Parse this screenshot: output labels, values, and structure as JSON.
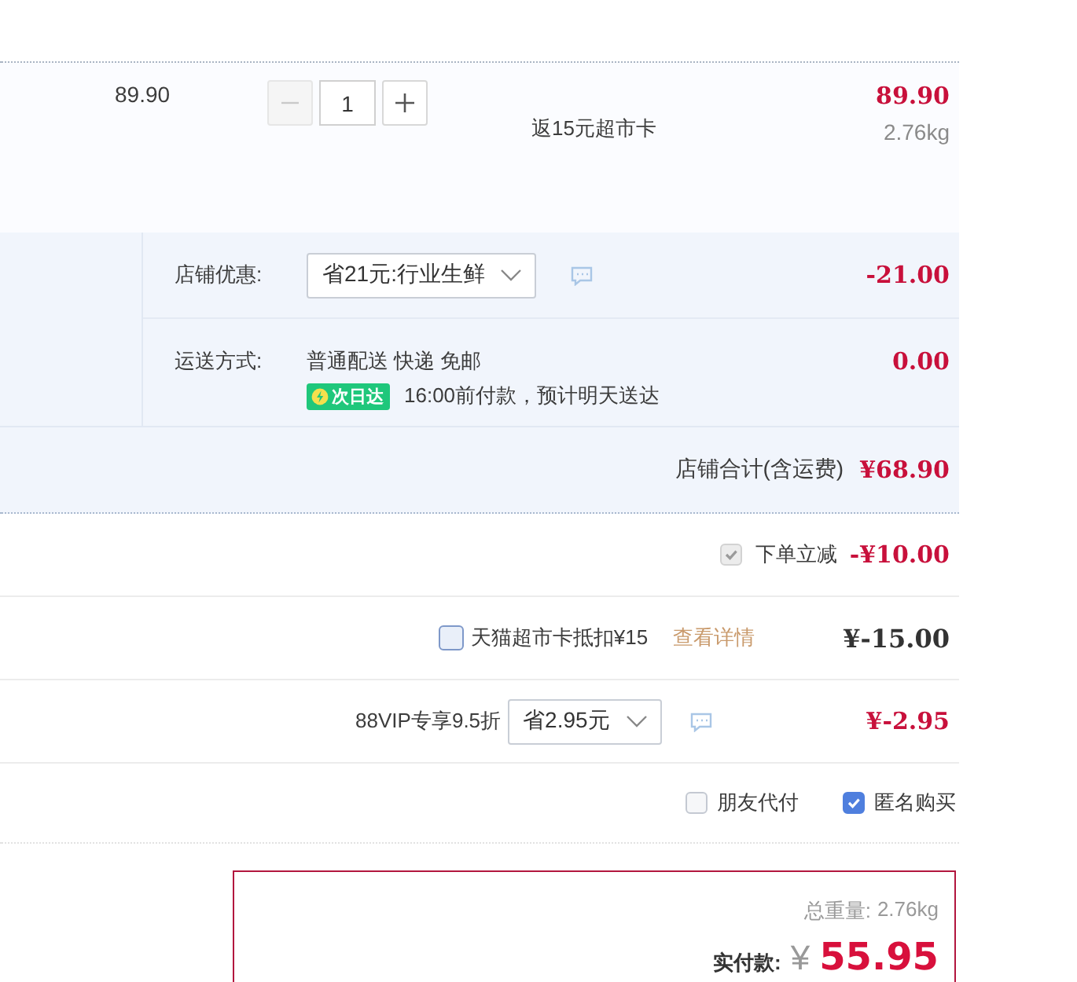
{
  "item": {
    "unit_price": "89.90",
    "quantity": "1",
    "promo": "返15元超市卡",
    "subtotal": "89.90",
    "weight": "2.76kg"
  },
  "store": {
    "discount": {
      "label": "店铺优惠:",
      "select": "省21元:行业生鲜",
      "amount": "-21.00"
    },
    "shipping": {
      "label": "运送方式:",
      "method": "普通配送 快递 免邮",
      "badge": "次日达",
      "note": "16:00前付款，预计明天送达",
      "amount": "0.00"
    },
    "total_label": "店铺合计(含运费)",
    "total": "¥68.90"
  },
  "adjustments": [
    {
      "kind": "checkbox",
      "label": "下单立减",
      "checked": true,
      "disabled": true,
      "amount": "-¥10.00"
    },
    {
      "kind": "card",
      "label": "天猫超市卡抵扣¥15",
      "checked": false,
      "link": "查看详情",
      "amount": "¥-15.00"
    },
    {
      "kind": "select",
      "label": "88VIP专享9.5折",
      "select": "省2.95元",
      "amount": "¥-2.95"
    }
  ],
  "options": [
    {
      "label": "朋友代付",
      "checked": false
    },
    {
      "label": "匿名购买",
      "checked": true
    }
  ],
  "summary": {
    "weight_label": "总重量:",
    "weight": "2.76kg",
    "pay_label": "实付款:",
    "currency": "¥",
    "pay": "55.95"
  }
}
